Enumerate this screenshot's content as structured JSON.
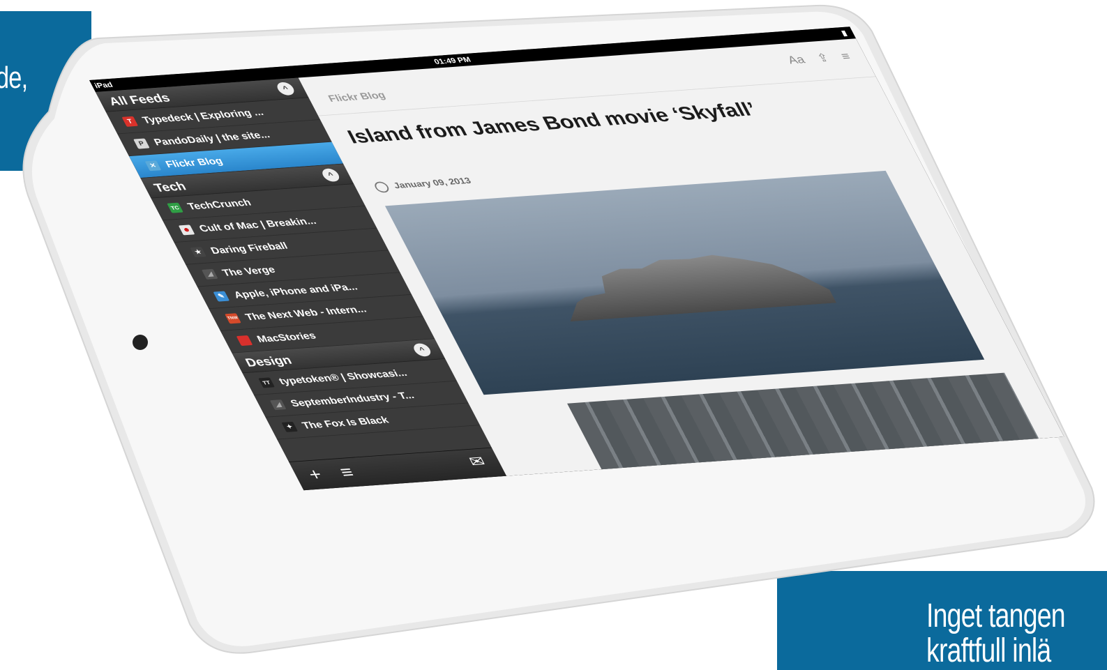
{
  "callouts": {
    "left_fragment": "de,",
    "right_line1": "Inget tangen",
    "right_line2": "kraftfull inlä"
  },
  "statusbar": {
    "carrier": "iPad",
    "time": "01:49 PM",
    "battery": "▮"
  },
  "sidebar": {
    "sections": [
      {
        "title": "All Feeds",
        "collapse_glyph": "^",
        "feeds": [
          {
            "icon": "T",
            "label": "Typedeck | Exploring ...",
            "icon_color": "#d9322b"
          },
          {
            "icon": "P",
            "label": "PandoDaily | the site...",
            "icon_color": "#d8d8d8"
          },
          {
            "icon": "✕",
            "label": "Flickr Blog",
            "icon_color": "#5aa9d9",
            "active": true
          }
        ]
      },
      {
        "title": "Tech",
        "collapse_glyph": "^",
        "feeds": [
          {
            "icon": "TC",
            "label": "TechCrunch",
            "icon_color": "#2f9f45"
          },
          {
            "icon": "☻",
            "label": "Cult of Mac | Breakin...",
            "icon_color": "#e8e8e8"
          },
          {
            "icon": "★",
            "label": "Daring Fireball",
            "icon_color": "#444"
          },
          {
            "icon": "◢",
            "label": "The Verge",
            "icon_color": "#555"
          },
          {
            "icon": "✎",
            "label": "Apple, iPhone and iPa...",
            "icon_color": "#3b8fd6"
          },
          {
            "icon": "TNW",
            "label": "The Next Web - Intern...",
            "icon_color": "#d64a2a"
          },
          {
            "icon": "■",
            "label": "MacStories",
            "icon_color": "#d9302c"
          }
        ]
      },
      {
        "title": "Design",
        "collapse_glyph": "^",
        "feeds": [
          {
            "icon": "TT",
            "label": "typetoken® | Showcasi...",
            "icon_color": "#222"
          },
          {
            "icon": "◢",
            "label": "SeptemberIndustry - T...",
            "icon_color": "#555"
          },
          {
            "icon": "✦",
            "label": "The Fox Is Black",
            "icon_color": "#222"
          }
        ]
      }
    ],
    "footer": {
      "add_glyph": "+",
      "list_glyph": "≡",
      "mail_glyph": "✉"
    }
  },
  "reader": {
    "feed_label": "Flickr Blog",
    "tools": {
      "font": "Aa",
      "share": "⇪",
      "menu": "≡"
    },
    "title": "Island from James Bond movie ‘Skyfall’",
    "date": "January 09, 2013"
  }
}
